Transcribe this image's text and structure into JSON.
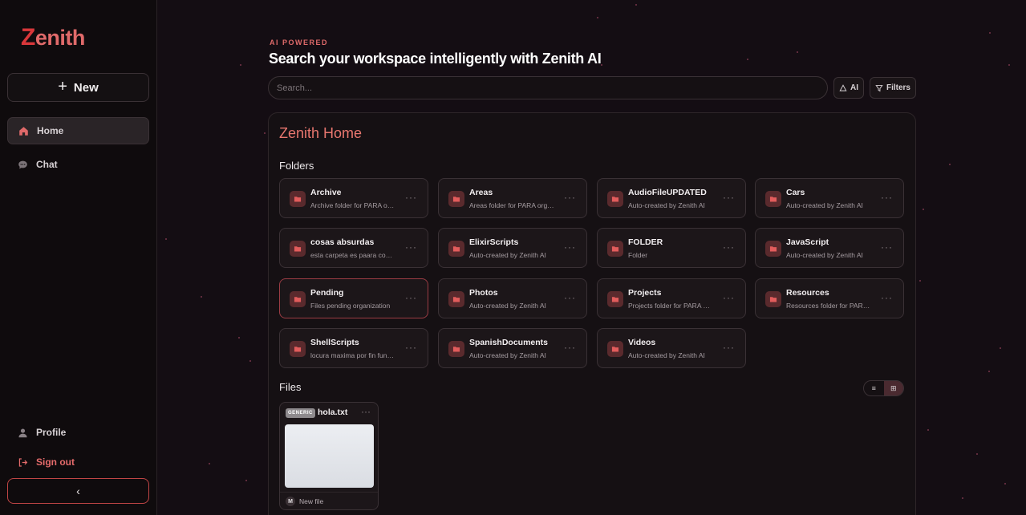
{
  "app": {
    "logo_initial": "Z",
    "logo_rest": "enith"
  },
  "sidebar": {
    "new_label": "New",
    "items": [
      {
        "label": "Home",
        "icon": "home-icon",
        "active": true
      },
      {
        "label": "Chat",
        "icon": "chat-icon",
        "active": false
      }
    ],
    "bottom": [
      {
        "label": "Profile",
        "icon": "user-icon"
      },
      {
        "label": "Sign out",
        "icon": "sign-out-icon"
      }
    ],
    "collapse_icon": "‹"
  },
  "header": {
    "eyebrow": "AI POWERED",
    "title": "Search your workspace intelligently with Zenith AI"
  },
  "search": {
    "placeholder": "Search...",
    "value": ""
  },
  "toolbar": {
    "ai_label": "AI",
    "filters_label": "Filters"
  },
  "panel": {
    "title": "Zenith Home",
    "folders_title": "Folders",
    "files_title": "Files",
    "folders": [
      {
        "name": "Archive",
        "desc": "Archive folder for PARA organization"
      },
      {
        "name": "Areas",
        "desc": "Areas folder for PARA organization"
      },
      {
        "name": "AudioFileUPDATED",
        "desc": "Auto-created by Zenith AI"
      },
      {
        "name": "Cars",
        "desc": "Auto-created by Zenith AI"
      },
      {
        "name": "cosas absurdas",
        "desc": "esta carpeta es paara cosas absurdas"
      },
      {
        "name": "ElixirScripts",
        "desc": "Auto-created by Zenith AI"
      },
      {
        "name": "FOLDER",
        "desc": "Folder"
      },
      {
        "name": "JavaScript",
        "desc": "Auto-created by Zenith AI"
      },
      {
        "name": "Pending",
        "desc": "Files pending organization"
      },
      {
        "name": "Photos",
        "desc": "Auto-created by Zenith AI"
      },
      {
        "name": "Projects",
        "desc": "Projects folder for PARA organization"
      },
      {
        "name": "Resources",
        "desc": "Resources folder for PARA organization"
      },
      {
        "name": "ShellScripts",
        "desc": "locura maxima por fin funciona"
      },
      {
        "name": "SpanishDocuments",
        "desc": "Auto-created by Zenith AI"
      },
      {
        "name": "Videos",
        "desc": "Auto-created by Zenith AI"
      }
    ],
    "view_toggle": {
      "list": "≡",
      "grid": "⊞",
      "selected": "grid"
    },
    "files": [
      {
        "badge": "GENERIC",
        "name": "hola.txt",
        "avatar": "M",
        "footer": "New file"
      }
    ]
  },
  "colors": {
    "accent": "#e06a6a",
    "brand_red": "#d8373a",
    "background": "#140d13"
  }
}
